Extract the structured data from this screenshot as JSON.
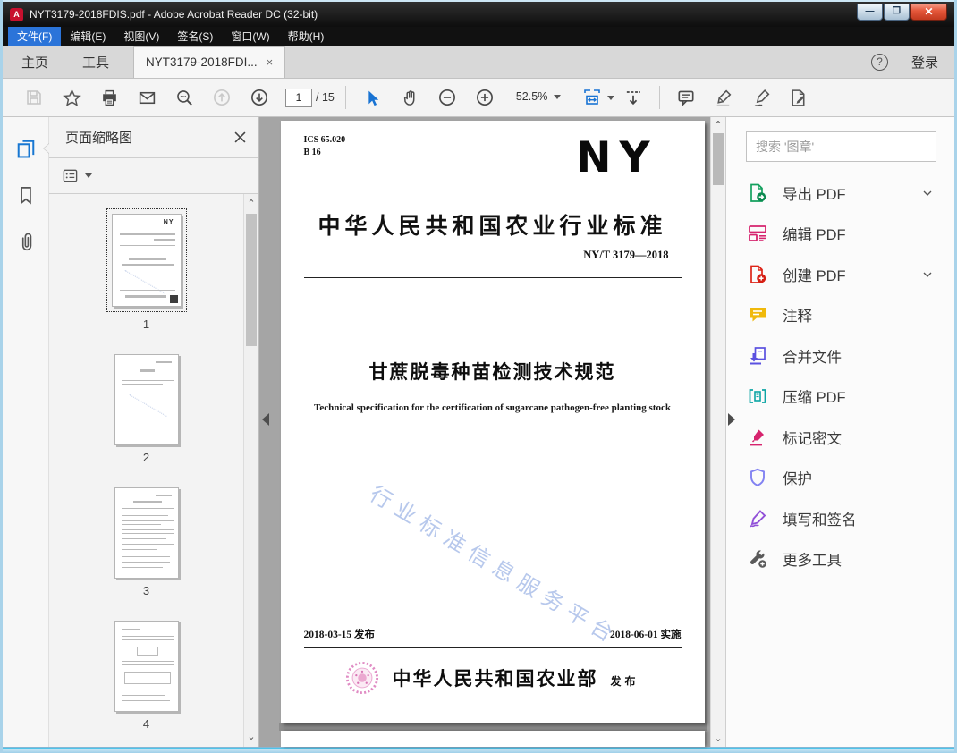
{
  "window": {
    "title": "NYT3179-2018FDIS.pdf - Adobe Acrobat Reader DC (32-bit)"
  },
  "menu": {
    "items": [
      {
        "label": "文件(F)"
      },
      {
        "label": "编辑(E)"
      },
      {
        "label": "视图(V)"
      },
      {
        "label": "签名(S)"
      },
      {
        "label": "窗口(W)"
      },
      {
        "label": "帮助(H)"
      }
    ]
  },
  "tabs": {
    "home": "主页",
    "tools": "工具",
    "document": "NYT3179-2018FDI...",
    "close": "×",
    "help": "?",
    "login": "登录"
  },
  "toolbar": {
    "page_current": "1",
    "page_total": "/ 15",
    "zoom_level": "52.5%"
  },
  "left_panel": {
    "title": "页面缩略图",
    "thumbnails": [
      {
        "number": "1"
      },
      {
        "number": "2"
      },
      {
        "number": "3"
      },
      {
        "number": "4"
      }
    ]
  },
  "right_panel": {
    "search_placeholder": "搜索 '图章'",
    "tools": [
      {
        "label": "导出 PDF"
      },
      {
        "label": "编辑 PDF"
      },
      {
        "label": "创建 PDF"
      },
      {
        "label": "注释"
      },
      {
        "label": "合并文件"
      },
      {
        "label": "压缩 PDF"
      },
      {
        "label": "标记密文"
      },
      {
        "label": "保护"
      },
      {
        "label": "填写和签名"
      },
      {
        "label": "更多工具"
      }
    ]
  },
  "document": {
    "ics": "ICS 65.020",
    "code": "B 16",
    "logo": "NY",
    "heading": "中华人民共和国农业行业标准",
    "number": "NY/T 3179—2018",
    "title_cn": "甘蔗脱毒种苗检测技术规范",
    "title_en": "Technical specification for the certification of sugarcane pathogen-free planting stock",
    "watermark": "行业标准信息服务平台",
    "issue_date": "2018-03-15 发布",
    "impl_date": "2018-06-01 实施",
    "publisher": "中华人民共和国农业部",
    "publish_label": "发布"
  },
  "colors": {
    "accent_blue": "#1873d3",
    "menu_highlight": "#2b74d9",
    "close_red": "#d6492f",
    "export_green": "#14a05e",
    "edit_magenta": "#d6246e",
    "create_red": "#dd2418",
    "comment_yellow": "#f0b90b",
    "combine_indigo": "#5b51e0",
    "compress_teal": "#0da5a5",
    "protect_purple": "#8282f2",
    "sign_purple": "#9150d8",
    "watermark_blue": "#b7c8ec"
  }
}
